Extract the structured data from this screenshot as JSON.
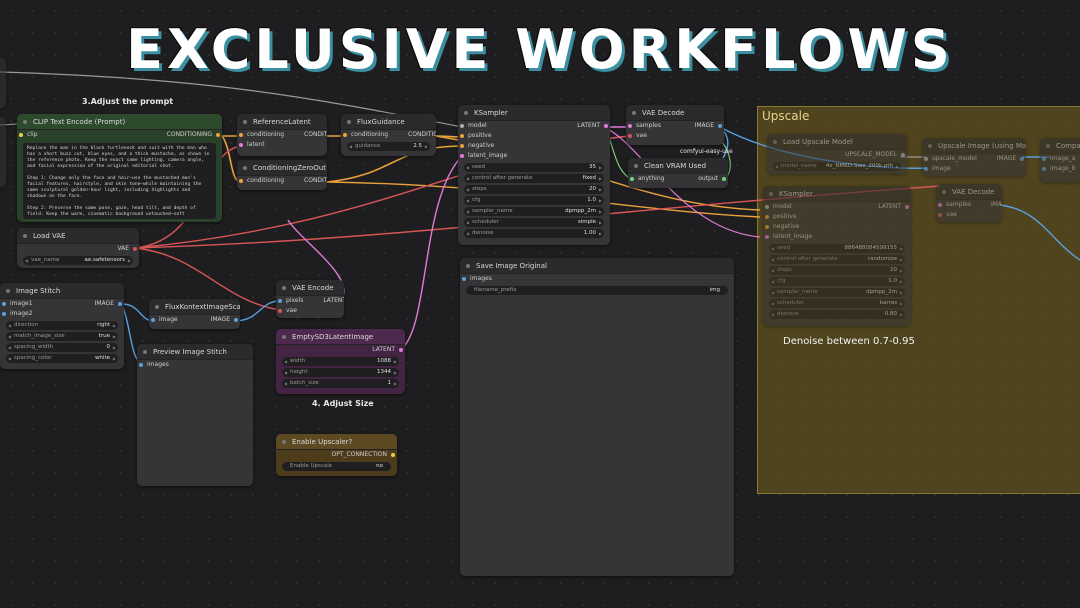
{
  "headline": "EXCLUSIVE WORKFLOWS",
  "labels": {
    "adjust_prompt": "3.Adjust the prompt",
    "adjust_size": "4. Adjust Size",
    "denoise": "Denoise between 0.7-0.95"
  },
  "group": {
    "title": "Upscale"
  },
  "clip_text_encode": {
    "title": "CLIP Text Encode (Prompt)",
    "in_clip": "clip",
    "out": "CONDITIONING",
    "text": "Replace the man in the black turtleneck and suit with the man who has a short buzz cut, blue eyes, and a thick mustache, as shown in the reference photo. Keep the exact same lighting, camera angle, and facial expression of the original editorial shot.\n\nStep 1: Change only the face and hair—use the mustached man's facial features, hairstyle, and skin tone—while maintaining the same sculptural golden-hour light, including highlights and shadows on the face.\n\nStep 2: Preserve the same pose, gaze, head tilt, and depth of field. Keep the warm, cinematic background untouched—soft"
  },
  "reference_latent": {
    "title": "ReferenceLatent",
    "in_conditioning": "conditioning",
    "out": "CONDITIONING",
    "in_latent": "latent"
  },
  "conditioning_zero_out": {
    "title": "ConditioningZeroOut",
    "in_conditioning": "conditioning",
    "out": "CONDITIONING"
  },
  "flux_guidance": {
    "title": "FluxGuidance",
    "in_conditioning": "conditioning",
    "out": "CONDITIONING",
    "w_guidance": "guidance",
    "v_guidance": "2.5"
  },
  "ksampler": {
    "title": "KSampler",
    "in_model": "model",
    "out": "LATENT",
    "in_positive": "positive",
    "in_negative": "negative",
    "in_latent": "latent_image",
    "widgets": [
      {
        "label": "seed",
        "value": "35"
      },
      {
        "label": "control after generate",
        "value": "fixed"
      },
      {
        "label": "steps",
        "value": "20"
      },
      {
        "label": "cfg",
        "value": "1.0"
      },
      {
        "label": "sampler_name",
        "value": "dpmpp_2m"
      },
      {
        "label": "scheduler",
        "value": "simple"
      },
      {
        "label": "denoise",
        "value": "1.00"
      }
    ]
  },
  "vae_decode": {
    "title": "VAE Decode",
    "in_samples": "samples",
    "out": "IMAGE",
    "in_vae": "vae",
    "tag": "comfyui-easy-use"
  },
  "clean_vram": {
    "title": "Clean VRAM Used",
    "in_anything": "anything",
    "out": "output"
  },
  "load_vae": {
    "title": "Load VAE",
    "out": "VAE",
    "w_name": "vae_name",
    "v_name": "ae.safetensors"
  },
  "save_image": {
    "title": "Save Image Original",
    "in_images": "images",
    "w_prefix": "filename_prefix",
    "v_prefix": "img"
  },
  "image_stitch": {
    "title": "Image Stitch",
    "in_image1": "image1",
    "out": "IMAGE",
    "in_image2": "image2",
    "widgets": [
      {
        "label": "direction",
        "value": "right"
      },
      {
        "label": "match_image_size",
        "value": "true"
      },
      {
        "label": "spacing_width",
        "value": "0"
      },
      {
        "label": "spacing_color",
        "value": "white"
      }
    ]
  },
  "flux_kontext_scale": {
    "title": "FluxKontextImageScale",
    "in_image": "image",
    "out": "IMAGE"
  },
  "vae_encode": {
    "title": "VAE Encode",
    "in_pixels": "pixels",
    "out": "LATENT",
    "in_vae": "vae"
  },
  "preview_stitch": {
    "title": "Preview Image Stitch",
    "in_images": "images"
  },
  "empty_latent": {
    "title": "EmptySD3LatentImage",
    "out": "LATENT",
    "widgets": [
      {
        "label": "width",
        "value": "1088"
      },
      {
        "label": "height",
        "value": "1344"
      },
      {
        "label": "batch_size",
        "value": "1"
      }
    ]
  },
  "enable_upscaler": {
    "title": "Enable Upscaler?",
    "out": "OPT_CONNECTION",
    "w_label": "Enable Upscale",
    "v_state": "no"
  },
  "load_upscale_model": {
    "title": "Load Upscale Model",
    "out": "UPSCALE_MODEL",
    "w_name": "model_name",
    "v_name": "4x_NMKD-Siax_200k.pth"
  },
  "upscale_image": {
    "title": "Upscale Image (using Model)",
    "in_model": "upscale_model",
    "out": "IMAGE",
    "in_image": "image"
  },
  "ksampler2": {
    "title": "KSampler",
    "in_model": "model",
    "out": "LATENT",
    "in_positive": "positive",
    "in_negative": "negative",
    "in_latent": "latent_image",
    "widgets": [
      {
        "label": "seed",
        "value": "886488084599155"
      },
      {
        "label": "control after generate",
        "value": "randomize"
      },
      {
        "label": "steps",
        "value": "20"
      },
      {
        "label": "cfg",
        "value": "1.0"
      },
      {
        "label": "sampler_name",
        "value": "dpmpp_2m"
      },
      {
        "label": "scheduler",
        "value": "karras"
      },
      {
        "label": "denoise",
        "value": "0.80"
      }
    ]
  },
  "vae_decode2": {
    "title": "VAE Decode",
    "in_samples": "samples",
    "out": "IMAGE",
    "in_vae": "vae"
  },
  "compare_node": {
    "title": "Compare",
    "in_a": "image_a",
    "in_b": "image_b"
  },
  "colors": {
    "wire_conditioning": "#e9a13b",
    "wire_vae": "#e05a5a",
    "wire_image": "#5aa0e0",
    "wire_latent": "#e07ad6",
    "wire_model": "#b0b0b0",
    "group_fill": "#786420"
  }
}
